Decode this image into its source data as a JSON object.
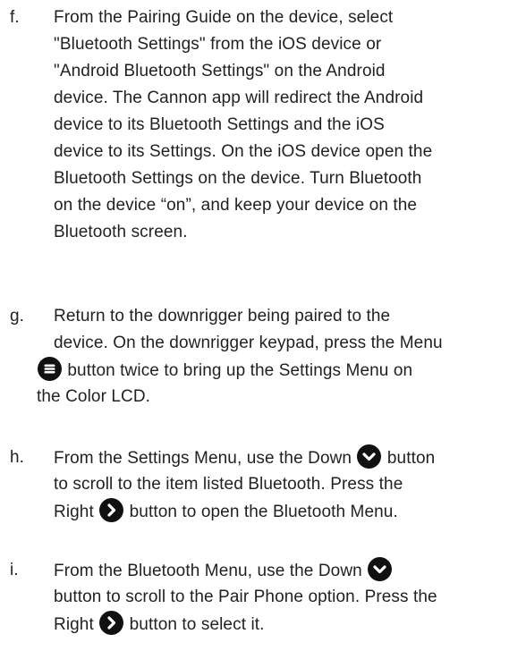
{
  "steps": [
    {
      "marker": "f.",
      "lines": [
        "From the Pairing Guide on the device, select",
        "\"Bluetooth Settings\" from the iOS device or",
        "\"Android Bluetooth Settings\" on the Android",
        "device. The Cannon app will redirect the Android",
        "device to its Bluetooth Settings and the iOS",
        "device to its Settings. On the iOS device open the",
        "Bluetooth Settings on the device. Turn Bluetooth",
        "on the device “on”, and keep your device on the",
        "Bluetooth screen."
      ]
    },
    {
      "marker": "g.",
      "line1": "Return to the downrigger being paired to the",
      "line2": "device. On the downrigger keypad, press the Menu",
      "line3_after_icon": " button twice to bring up the Settings Menu on",
      "line4": "the Color LCD."
    },
    {
      "marker": "h.",
      "line1_before_icon": "From the Settings Menu, use the Down ",
      "line1_after_icon": " button",
      "line2": "to scroll to the item listed Bluetooth. Press the",
      "line3_before_icon": "Right ",
      "line3_after_icon": " button to open the Bluetooth Menu."
    },
    {
      "marker": "i.",
      "line1_before_icon": "From the Bluetooth Menu, use the Down ",
      "line2": "button to scroll to the Pair Phone option. Press the",
      "line3_before_icon": "Right ",
      "line3_after_icon": " button to select it."
    }
  ],
  "icons": {
    "menu": "menu-icon",
    "down": "chevron-down-icon",
    "right": "chevron-right-icon",
    "color": "#111111"
  }
}
